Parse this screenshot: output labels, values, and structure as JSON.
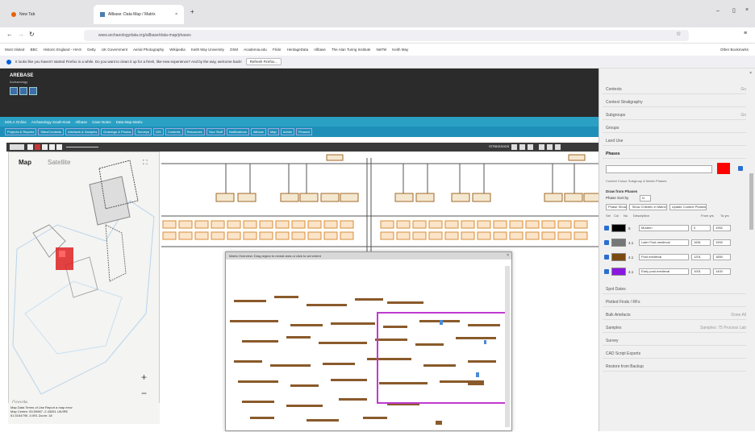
{
  "browser": {
    "tabs": [
      {
        "label": "New Tab"
      },
      {
        "label": "Allbase: Data Map / Matrix"
      }
    ],
    "new_tab_symbol": "+",
    "url": "www.archaeologydata.org/allbase/data-map/phases",
    "bookmarks": [
      "Most Visited",
      "BBC",
      "Historic England - HIAS",
      "Getty",
      "UK Government",
      "Aerial Photography",
      "Wikipedia",
      "Keith May University",
      "OSM",
      "Academia.edu",
      "Flickr",
      "HeritageData",
      "Allbase",
      "The Alan Turing Institute",
      "NetTel",
      "Keith May"
    ],
    "bookmarks_other": "Other Bookmarks",
    "notification": "It looks like you haven't started Firefox in a while. Do you want to clean it up for a fresh, like-new experience? And by the way, welcome back!",
    "notification_button": "Refresh Firefox...",
    "colors": {
      "tabbar": "#e4e4e7",
      "accent": "#2aa0c4"
    }
  },
  "app": {
    "title": "AREBASE",
    "subtitle": "Archaeology",
    "nav": [
      "MOLA Online",
      "Archaeology South-East",
      "Allbase",
      "Case Notes",
      "Data Map Matrix"
    ],
    "menu": [
      "Projects & Reports",
      "Sites/Contexts",
      "Artefacts & Samples",
      "Drawings & Photos",
      "Surveys",
      "GIS",
      "Contexts",
      "Resources",
      "Your Stuff",
      "Notifications",
      "Allbase",
      "Map",
      "Admin",
      "Finance"
    ],
    "toolbar_label": "STRIKE/DIGS"
  },
  "map": {
    "map_label": "Map",
    "satellite_label": "Satellite",
    "zoom_in": "+",
    "zoom_out": "−",
    "google": "Google",
    "status1": "Map Data   Terms of Use   Report a map error",
    "status2": "Map Centre: 53.59987 -2.43051   UK/IRE",
    "status3": "51.5154795 -0.091   Zoom: 18"
  },
  "matrix": {
    "title": "Matrix Overview: Drag region to reveal area or click to set extent"
  },
  "sidebar": {
    "sections_top": [
      "Contexts",
      "Context Stratigraphy",
      "Subgroups",
      "Groups",
      "Land Use",
      "Phases"
    ],
    "phases_label": "Phases",
    "controls": "Context Colour Subgroup & Matrix Phases",
    "draw_title": "Draw from Phases",
    "phase_sort_label": "Phase Sort by",
    "phase_sort_value": "N",
    "buttons": [
      "Phase Show",
      "Show Children in Matrix",
      "Update Context Phases"
    ],
    "table_headers": [
      "Sel",
      "Col",
      "No",
      "Description",
      "From yrs",
      "To yrs"
    ],
    "phases": [
      {
        "no": "5",
        "desc": "Modern",
        "from": "0",
        "to": "1952",
        "color": "#000000"
      },
      {
        "no": "4.1",
        "desc": "Later Post-medieval",
        "from": "1651",
        "to": "1900",
        "color": "#777777"
      },
      {
        "no": "4.1",
        "desc": "Post medieval",
        "from": "1201",
        "to": "1850",
        "color": "#7a4a10"
      },
      {
        "no": "4.1",
        "desc": "Early post-medieval",
        "from": "1001",
        "to": "1400",
        "color": "#8a18e0"
      }
    ],
    "sections_bottom": [
      "Spot Dates",
      "Plotted Finds / RFs",
      "Bulk Artefacts",
      "Samples",
      "Survey",
      "CAD Script Exports",
      "Restore from Backup"
    ],
    "aside_labels": {
      "contexts": "Go",
      "subgroups": "Go",
      "samples": "Samples: 75 Process Lab",
      "bulk": "Done All"
    },
    "colors": {
      "phase_swatch": "#ff0000"
    }
  }
}
